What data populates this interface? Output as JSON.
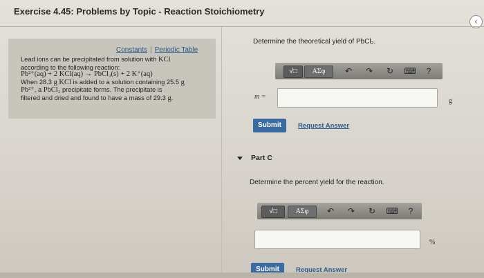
{
  "header": {
    "title": "Exercise 4.45: Problems by Topic - Reaction Stoichiometry",
    "nav_icon": "chevron-left-icon"
  },
  "left": {
    "links": {
      "constants": "Constants",
      "separator": "|",
      "periodic": "Periodic Table"
    },
    "problem": {
      "line1": "Lead ions can be precipitated from solution with",
      "line1_formula": "KCl",
      "line2": "according to the following reaction:",
      "equation": "Pb²⁺(aq) + 2 KCl(aq) → PbCl₂(s) + 2 K⁺(aq)",
      "line4a": "When 28.3",
      "line4_g": "g",
      "line4_kcl": "KCl",
      "line4b": "is added to a solution containing 25.5",
      "line4c": "g",
      "line5_ion": "Pb²⁺",
      "line5a": ", a",
      "line5_pbcl2": "PbCl₂",
      "line5b": "precipitate forms. The precipitate is",
      "line6": "filtered and dried and found to have a mass of 29.3",
      "line6_g": "g",
      "line6_end": "."
    }
  },
  "partB": {
    "question": "Determine the theoretical yield of PbCl₂.",
    "toolbar": {
      "sqrt_label": "√□",
      "greek_label": "ΑΣφ",
      "undo": "↶",
      "redo": "↷",
      "reset": "↻",
      "keyboard": "⌨",
      "help": "?"
    },
    "var_label": "m =",
    "input_value": "",
    "unit": "g",
    "submit": "Submit",
    "request": "Request Answer"
  },
  "partC": {
    "heading": "Part C",
    "question": "Determine the percent yield for the reaction.",
    "toolbar": {
      "sqrt_label": "√□",
      "greek_label": "ΑΣφ",
      "undo": "↶",
      "redo": "↷",
      "reset": "↻",
      "keyboard": "⌨",
      "help": "?"
    },
    "input_value": "",
    "unit": "%",
    "submit": "Submit",
    "request": "Request Answer"
  }
}
